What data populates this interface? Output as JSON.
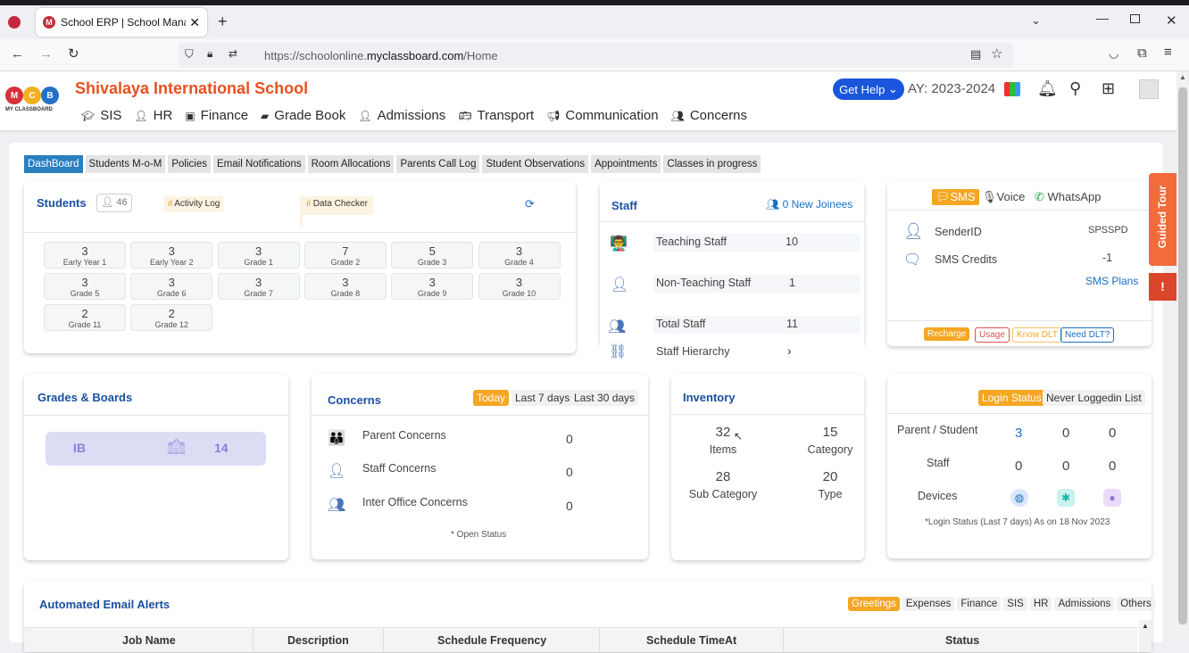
{
  "browser": {
    "tab_title": "School ERP | School Manageme",
    "url_prefix": "https://schoolonline.",
    "url_domain": "myclassboard.com",
    "url_path": "/Home"
  },
  "header": {
    "school_name": "Shivalaya International School",
    "logo_text": "MY CLASSBOARD",
    "get_help": "Get Help",
    "ay": "AY: 2023-2024",
    "nav": [
      "SIS",
      "HR",
      "Finance",
      "Grade Book",
      "Admissions",
      "Transport",
      "Communication",
      "Concerns"
    ]
  },
  "subtabs": [
    "DashBoard",
    "Students M-o-M",
    "Policies",
    "Email Notifications",
    "Room Allocations",
    "Parents Call Log",
    "Student Observations",
    "Appointments",
    "Classes in progress"
  ],
  "students": {
    "title": "Students",
    "count": "46",
    "activity_log": "Activity Log",
    "data_checker": "Data Checker",
    "grades": [
      {
        "n": "3",
        "l": "Early Year 1"
      },
      {
        "n": "3",
        "l": "Early Year 2"
      },
      {
        "n": "3",
        "l": "Grade 1"
      },
      {
        "n": "7",
        "l": "Grade 2"
      },
      {
        "n": "5",
        "l": "Grade 3"
      },
      {
        "n": "3",
        "l": "Grade 4"
      },
      {
        "n": "3",
        "l": "Grade 5"
      },
      {
        "n": "3",
        "l": "Grade 6"
      },
      {
        "n": "3",
        "l": "Grade 7"
      },
      {
        "n": "3",
        "l": "Grade 8"
      },
      {
        "n": "3",
        "l": "Grade 9"
      },
      {
        "n": "3",
        "l": "Grade 10"
      },
      {
        "n": "2",
        "l": "Grade 11"
      },
      {
        "n": "2",
        "l": "Grade 12"
      }
    ]
  },
  "staff": {
    "title": "Staff",
    "new_joinees": "0 New Joinees",
    "rows": [
      {
        "label": "Teaching Staff",
        "value": "10"
      },
      {
        "label": "Non-Teaching Staff",
        "value": "1"
      },
      {
        "label": "Total Staff",
        "value": "11"
      }
    ],
    "hierarchy": "Staff Hierarchy"
  },
  "sms": {
    "tabs": [
      "SMS",
      "Voice",
      "WhatsApp"
    ],
    "sender_label": "SenderID",
    "sender_value": "SPSSPD",
    "credits_label": "SMS Credits",
    "credits_value": "-1",
    "plans": "SMS Plans",
    "buttons": [
      "Recharge",
      "Usage",
      "Know DLT",
      "Need DLT?"
    ]
  },
  "guided_tour": "Guided Tour",
  "grades_boards": {
    "title": "Grades & Boards",
    "board": "IB",
    "count": "14"
  },
  "concerns": {
    "title": "Concerns",
    "filters": [
      "Today",
      "Last 7 days",
      "Last 30 days"
    ],
    "rows": [
      {
        "label": "Parent Concerns",
        "value": "0"
      },
      {
        "label": "Staff Concerns",
        "value": "0"
      },
      {
        "label": "Inter Office Concerns",
        "value": "0"
      }
    ],
    "footer": "* Open Status"
  },
  "inventory": {
    "title": "Inventory",
    "items": [
      {
        "n": "32",
        "l": "Items"
      },
      {
        "n": "15",
        "l": "Category"
      },
      {
        "n": "28",
        "l": "Sub Category"
      },
      {
        "n": "20",
        "l": "Type"
      }
    ]
  },
  "login": {
    "tabs": [
      "Login Status",
      "Never Loggedin List"
    ],
    "parent_label": "Parent / Student",
    "parent_vals": [
      "3",
      "0",
      "0"
    ],
    "staff_label": "Staff",
    "staff_vals": [
      "0",
      "0",
      "0"
    ],
    "devices_label": "Devices",
    "footer": "*Login Status (Last 7 days) As on 18 Nov 2023"
  },
  "email_alerts": {
    "title": "Automated Email Alerts",
    "tabs": [
      "Greetings",
      "Expenses",
      "Finance",
      "SIS",
      "HR",
      "Admissions",
      "Others"
    ],
    "columns": [
      "Job Name",
      "Description",
      "Schedule Frequency",
      "Schedule TimeAt",
      "Status"
    ]
  }
}
